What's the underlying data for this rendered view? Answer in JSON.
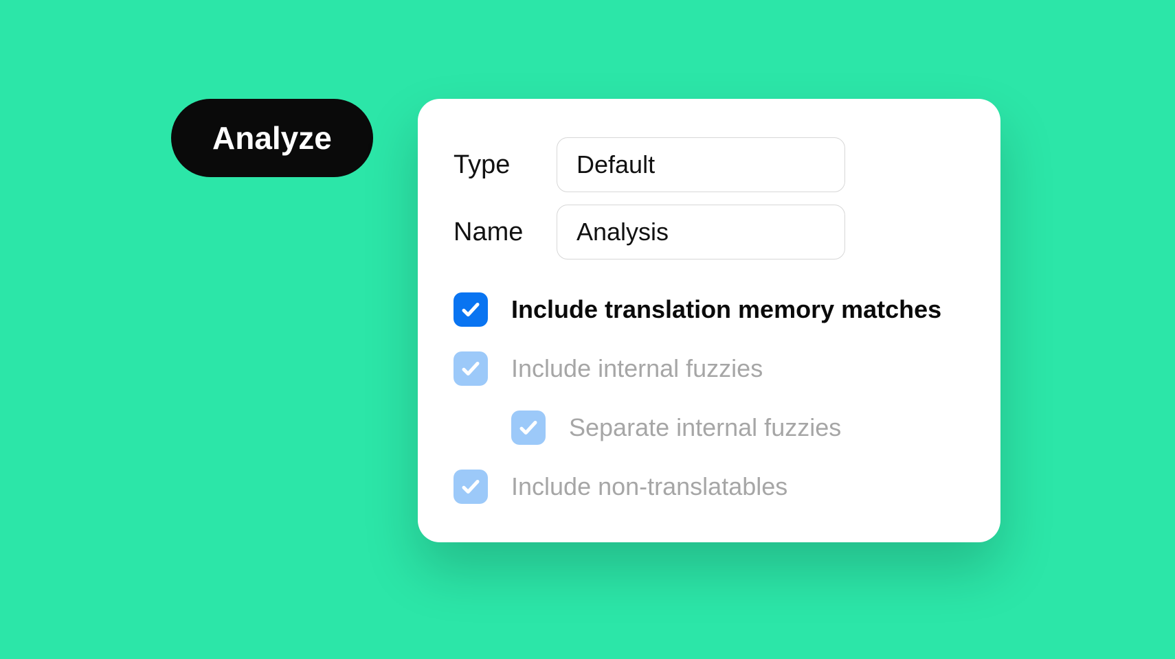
{
  "button": {
    "label": "Analyze"
  },
  "form": {
    "type_label": "Type",
    "type_value": "Default",
    "name_label": "Name",
    "name_value": "Analysis"
  },
  "options": {
    "include_tm_matches": "Include translation memory matches",
    "include_internal_fuzzies": "Include internal fuzzies",
    "separate_internal_fuzzies": "Separate internal fuzzies",
    "include_non_translatables": "Include non-translatables"
  }
}
